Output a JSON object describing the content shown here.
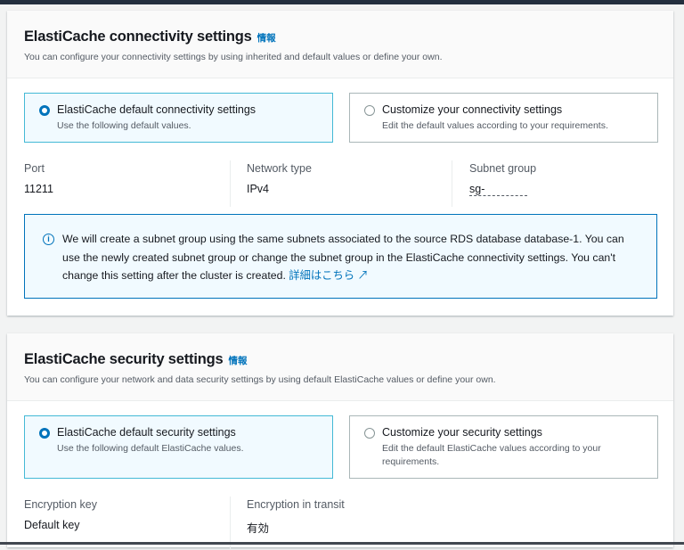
{
  "connectivity": {
    "title": "ElastiCache connectivity settings",
    "info": "情報",
    "subtitle": "You can configure your connectivity settings by using inherited and default values or define your own.",
    "options": [
      {
        "label": "ElastiCache default connectivity settings",
        "desc": "Use the following default values.",
        "selected": true
      },
      {
        "label": "Customize your connectivity settings",
        "desc": "Edit the default values according to your requirements.",
        "selected": false
      }
    ],
    "fields": [
      {
        "key": "Port",
        "value": "11211"
      },
      {
        "key": "Network type",
        "value": "IPv4"
      },
      {
        "key": "Subnet group",
        "value": "sg-"
      }
    ],
    "alert": {
      "text": "We will create a subnet group using the same subnets associated to the source RDS database database-1. You can use the newly created subnet group or change the subnet group in the ElastiCache connectivity settings. You can't change this setting after the cluster is created.",
      "link": "詳細はこちら",
      "icon": "info-icon"
    }
  },
  "security": {
    "title": "ElastiCache security settings",
    "info": "情報",
    "subtitle": "You can configure your network and data security settings by using default ElastiCache values or define your own.",
    "options": [
      {
        "label": "ElastiCache default security settings",
        "desc": "Use the following default ElastiCache values.",
        "selected": true
      },
      {
        "label": "Customize your security settings",
        "desc": "Edit the default ElastiCache values according to your requirements.",
        "selected": false
      }
    ],
    "fields": [
      {
        "key": "Encryption key",
        "value": "Default key"
      },
      {
        "key": "Encryption in transit",
        "value": "有効"
      }
    ]
  },
  "colors": {
    "accent": "#0073bb",
    "selected_border": "#44b9d6"
  }
}
